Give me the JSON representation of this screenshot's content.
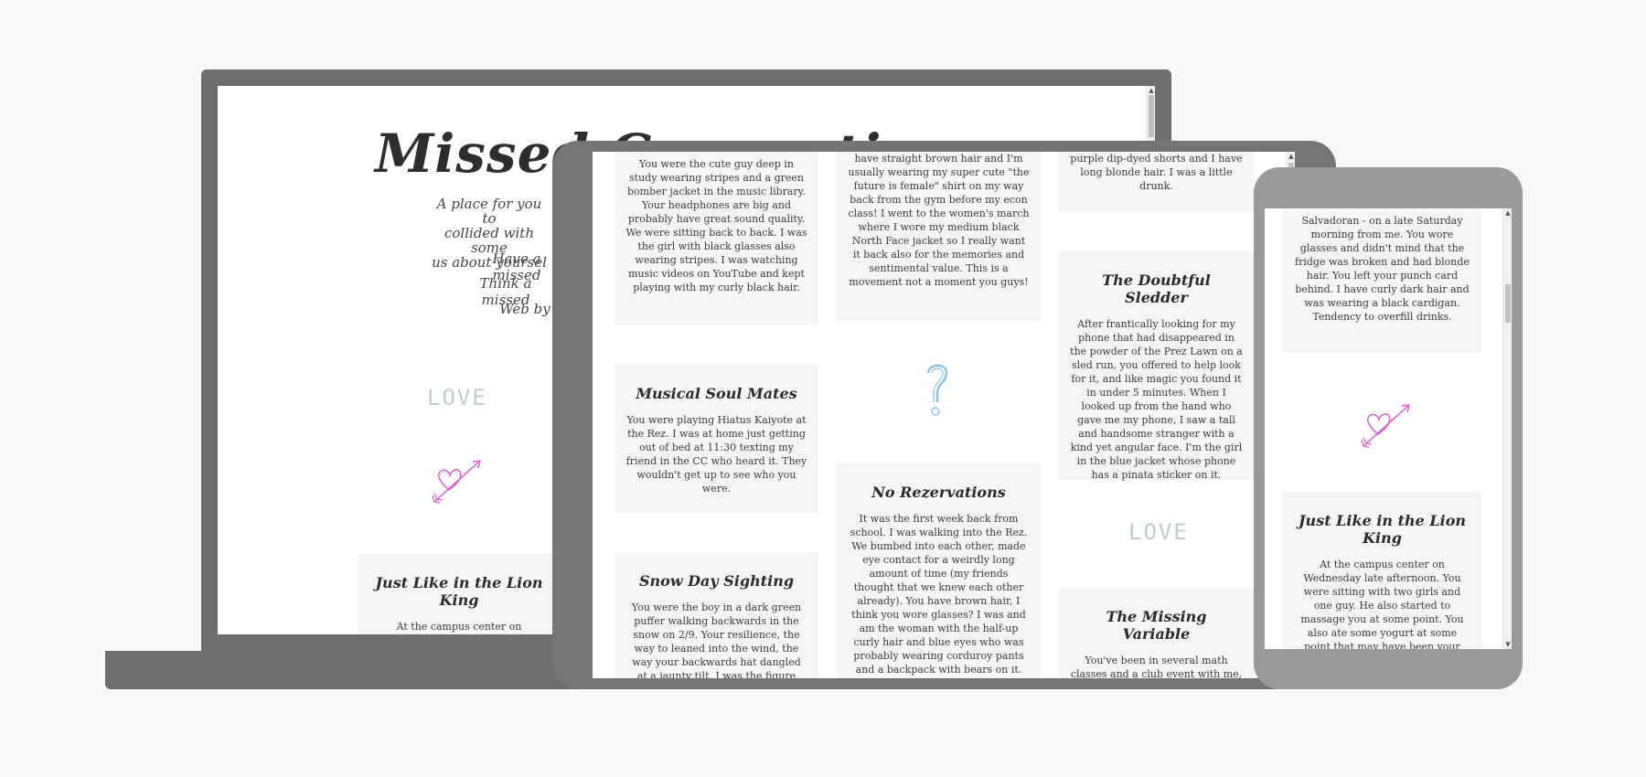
{
  "laptop": {
    "title": "Missed Connections",
    "intro_lines": [
      "A place for you to",
      "collided with some",
      "us about yoursel"
    ],
    "prompt_1": "Have a missed",
    "prompt_2": "Think a missed",
    "credit": "Web by",
    "love_text": "LOVE",
    "card": {
      "title": "Just Like in the Lion King",
      "text": "At the campus center on Wednesday late afternoon. You were sitting with two girls and"
    }
  },
  "tablet": {
    "col1": [
      {
        "title": "",
        "text": "You were the cute guy deep in study wearing stripes and a green bomber jacket in the music library. Your headphones are big and probably have great sound quality. We were sitting back to back. I was the girl with black glasses also wearing stripes. I was watching music videos on YouTube and kept playing with my curly black hair."
      },
      {
        "title": "Musical Soul Mates",
        "text": "You were playing Hiatus Kaiyote at the Rez. I was at home just getting out of bed at 11:30 texting my friend in the CC who heard it. They wouldn't get up to see who you were."
      },
      {
        "title": "Snow Day Sighting",
        "text": "You were the boy in a dark green puffer walking backwards in the snow on 2/9. Your resilience, the way to leaned into the wind, the way your backwards hat dangled at a jaunty tilt. I was the figure"
      }
    ],
    "col2": [
      {
        "title": "",
        "text": "have straight brown hair and I'm usually wearing my super cute \"the future is female\" shirt on my way back from the gym before my econ class! I went to the women's march where I wore my medium black North Face jacket so I really want it back also for the memories and sentimental value. This is a movement not a moment you guys!"
      },
      {
        "title": "No Rezervations",
        "text": "It was the first week back from school. I was walking into the Rez. We bumbed into each other, made eye contact for a weirdly long amount of time (my friends thought that we knew each other already). You have brown hair, I think you wore glasses? I was and am the woman with the half-up curly hair and blue eyes who was probably wearing corduroy pants and a backpack with bears on it."
      }
    ],
    "col3": [
      {
        "title": "",
        "text": "purple dip-dyed shorts and I have long blonde hair. I was a little drunk."
      },
      {
        "title": "The Doubtful Sledder",
        "text": "After frantically looking for my phone that had disappeared in the powder of the Prez Lawn on a sled run, you offered to help look for it, and like magic you found it in under 5 minutes. When I looked up from the hand who gave me my phone, I saw a tall and handsome stranger with a kind yet angular face. I'm the girl in the blue jacket whose phone has a pinata sticker on it."
      },
      {
        "title": "The Missing Variable",
        "text": "You've been in several math classes and a club event with me, and we always make intense eye"
      }
    ],
    "love_text": "LOVE"
  },
  "phone": {
    "card_top": {
      "text": "Salvadoran - on a late Saturday morning from me. You wore glasses and didn't mind that the fridge was broken and had blonde hair. You left your punch card behind. I have curly dark hair and was wearing a black cardigan. Tendency to overfill drinks."
    },
    "card": {
      "title": "Just Like in the Lion King",
      "text": "At the campus center on Wednesday late afternoon. You were sitting with two girls and one guy. He also started to massage you at some point. You also ate some yogurt at some point that may have been your friend's. Your short dark hair"
    }
  },
  "colors": {
    "device_dark": "#6e6e6e",
    "device_light": "#9a9a9a",
    "card_bg": "#f5f5f5",
    "heart_pink": "#e05ccf",
    "question_blue": "#8ec3e6"
  }
}
